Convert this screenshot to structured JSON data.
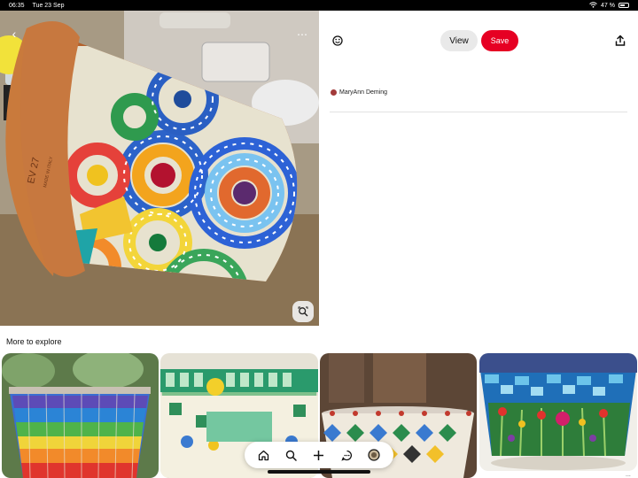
{
  "status_bar": {
    "time": "06:35",
    "date": "Tue 23 Sep",
    "battery": "47 %"
  },
  "pin": {
    "image_alt": "Mosaic-covered terracotta flower pot",
    "pot_marking_1": "EV 27",
    "pot_marking_2": "MADE IN ITALY"
  },
  "actions": {
    "view_label": "View",
    "save_label": "Save"
  },
  "author": {
    "name": "MaryAnn Deming"
  },
  "explore": {
    "title": "More to explore",
    "more": "..."
  },
  "icons": {
    "back": "chevron-left-icon",
    "more": "ellipsis-icon",
    "lens": "visual-search-icon",
    "reaction": "reaction-icon",
    "share": "share-icon",
    "nav": [
      "home-icon",
      "search-icon",
      "plus-icon",
      "messages-icon",
      "profile-icon"
    ]
  },
  "colors": {
    "save": "#e60023",
    "view_bg": "#e9e9e9"
  }
}
